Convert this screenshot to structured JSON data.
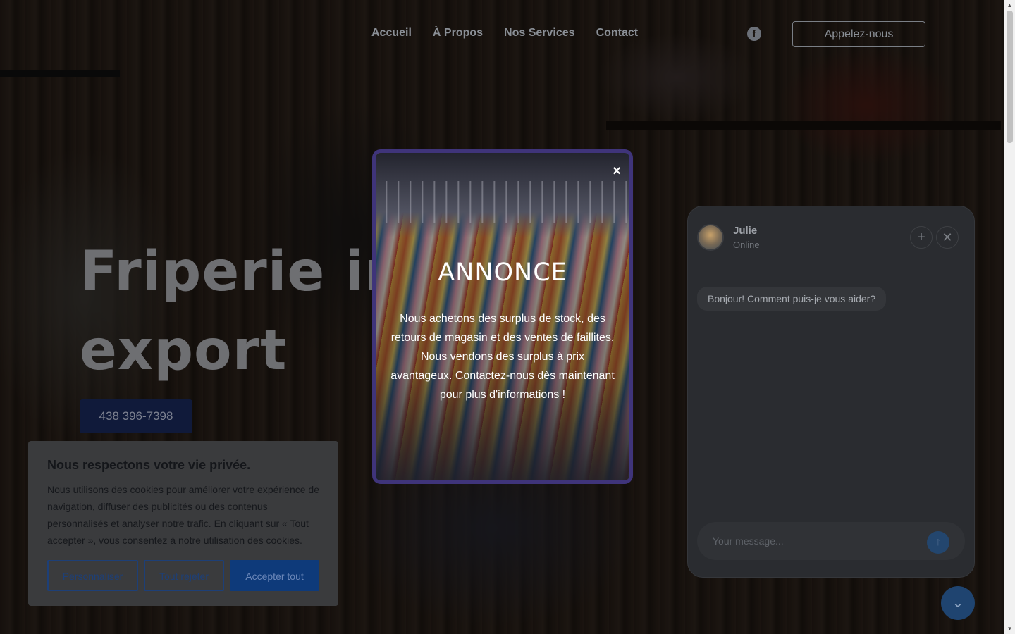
{
  "nav": {
    "links": [
      "Accueil",
      "À Propos",
      "Nos Services",
      "Contact"
    ],
    "facebook_icon": "f",
    "call_button": "Appelez-nous"
  },
  "hero": {
    "title_line1": "Friperie im",
    "title_line2": "export",
    "phone": "438 396-7398"
  },
  "modal": {
    "close": "×",
    "title": "ANNONCE",
    "text": "Nous achetons des surplus de stock, des retours de magasin et des ventes de faillites. Nous vendons des surplus à prix avantageux. Contactez-nous dès maintenant pour plus d'informations !"
  },
  "chat": {
    "agent_name": "Julie",
    "agent_status": "Online",
    "plus": "+",
    "close": "✕",
    "greeting": "Bonjour! Comment puis-je vous aider?",
    "input_placeholder": "Your message...",
    "send": "↑",
    "toggle": "⌄"
  },
  "cookie": {
    "title": "Nous respectons votre vie privée.",
    "text": "Nous utilisons des cookies pour améliorer votre expérience de navigation, diffuser des publicités ou des contenus personnalisés et analyser notre trafic. En cliquant sur « Tout accepter », vous consentez à notre utilisation des cookies.",
    "customize": "Personnaliser",
    "reject": "Tout rejeter",
    "accept": "Accepter tout"
  },
  "scrollbar": {
    "up": "▲",
    "down": "▼"
  }
}
